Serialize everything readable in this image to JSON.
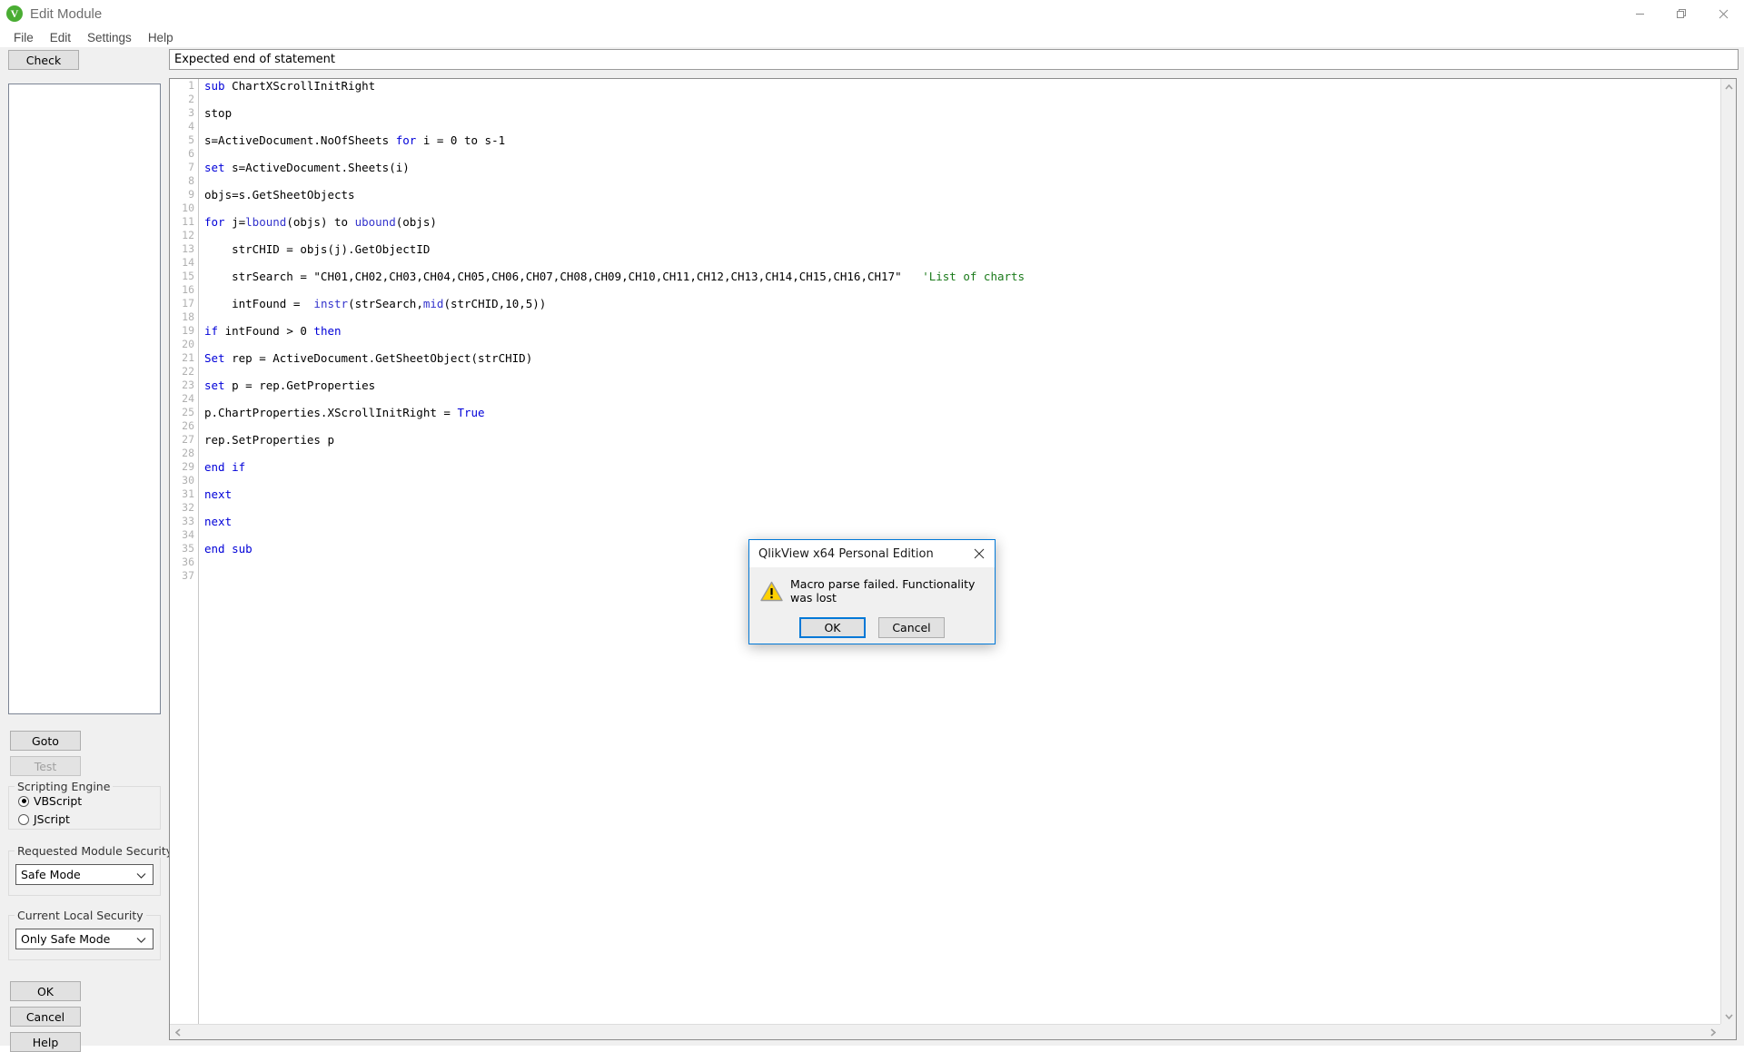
{
  "window": {
    "title": "Edit Module",
    "icon": "qlikview-logo-icon",
    "minimize_label": "–",
    "restore_label": "❐",
    "close_label": "✕"
  },
  "menubar": {
    "items": [
      {
        "label": "File"
      },
      {
        "label": "Edit"
      },
      {
        "label": "Settings"
      },
      {
        "label": "Help"
      }
    ]
  },
  "toolbar": {
    "check_label": "Check",
    "error_message": "Expected end of statement"
  },
  "sidebar": {
    "goto_label": "Goto",
    "test_label": "Test",
    "ok_label": "OK",
    "cancel_label": "Cancel",
    "help_label": "Help",
    "scripting_engine": {
      "title": "Scripting Engine",
      "options": [
        {
          "label": "VBScript",
          "selected": true
        },
        {
          "label": "JScript",
          "selected": false
        }
      ]
    },
    "requested_module_security": {
      "title": "Requested Module Security",
      "value": "Safe Mode"
    },
    "current_local_security": {
      "title": "Current Local Security",
      "value": "Only Safe Mode"
    }
  },
  "editor": {
    "total_lines": 37,
    "lines": [
      {
        "n": 1,
        "tokens": [
          {
            "t": "sub",
            "c": "kw"
          },
          {
            "t": " ChartXScrollInitRight",
            "c": ""
          }
        ]
      },
      {
        "n": 2,
        "tokens": []
      },
      {
        "n": 3,
        "tokens": [
          {
            "t": "stop",
            "c": ""
          }
        ]
      },
      {
        "n": 4,
        "tokens": []
      },
      {
        "n": 5,
        "tokens": [
          {
            "t": "s=ActiveDocument.NoOfSheets ",
            "c": ""
          },
          {
            "t": "for",
            "c": "kw"
          },
          {
            "t": " i = 0 to s-1",
            "c": ""
          }
        ]
      },
      {
        "n": 6,
        "tokens": []
      },
      {
        "n": 7,
        "tokens": [
          {
            "t": "set",
            "c": "kw"
          },
          {
            "t": " s=ActiveDocument.Sheets(i)",
            "c": ""
          }
        ]
      },
      {
        "n": 8,
        "tokens": []
      },
      {
        "n": 9,
        "tokens": [
          {
            "t": "objs=s.GetSheetObjects",
            "c": ""
          }
        ]
      },
      {
        "n": 10,
        "tokens": []
      },
      {
        "n": 11,
        "tokens": [
          {
            "t": "for",
            "c": "kw"
          },
          {
            "t": " j=",
            "c": ""
          },
          {
            "t": "lbound",
            "c": "fn"
          },
          {
            "t": "(objs) to ",
            "c": ""
          },
          {
            "t": "ubound",
            "c": "fn"
          },
          {
            "t": "(objs)",
            "c": ""
          }
        ]
      },
      {
        "n": 12,
        "tokens": []
      },
      {
        "n": 13,
        "tokens": [
          {
            "t": "    strCHID = objs(j).GetObjectID",
            "c": ""
          }
        ]
      },
      {
        "n": 14,
        "tokens": []
      },
      {
        "n": 15,
        "tokens": [
          {
            "t": "    strSearch = \"CH01,CH02,CH03,CH04,CH05,CH06,CH07,CH08,CH09,CH10,CH11,CH12,CH13,CH14,CH15,CH16,CH17\"   ",
            "c": ""
          },
          {
            "t": "'List of charts",
            "c": "cmt"
          }
        ]
      },
      {
        "n": 16,
        "tokens": []
      },
      {
        "n": 17,
        "tokens": [
          {
            "t": "    intFound =  ",
            "c": ""
          },
          {
            "t": "instr",
            "c": "fn"
          },
          {
            "t": "(strSearch,",
            "c": ""
          },
          {
            "t": "mid",
            "c": "fn"
          },
          {
            "t": "(strCHID,10,5))",
            "c": ""
          }
        ]
      },
      {
        "n": 18,
        "tokens": []
      },
      {
        "n": 19,
        "tokens": [
          {
            "t": "if",
            "c": "kw"
          },
          {
            "t": " intFound > 0 ",
            "c": ""
          },
          {
            "t": "then",
            "c": "kw"
          }
        ]
      },
      {
        "n": 20,
        "tokens": []
      },
      {
        "n": 21,
        "tokens": [
          {
            "t": "Set",
            "c": "kw"
          },
          {
            "t": " rep = ActiveDocument.GetSheetObject(strCHID)",
            "c": ""
          }
        ]
      },
      {
        "n": 22,
        "tokens": []
      },
      {
        "n": 23,
        "tokens": [
          {
            "t": "set",
            "c": "kw"
          },
          {
            "t": " p = rep.GetProperties",
            "c": ""
          }
        ]
      },
      {
        "n": 24,
        "tokens": []
      },
      {
        "n": 25,
        "tokens": [
          {
            "t": "p.ChartProperties.XScrollInitRight = ",
            "c": ""
          },
          {
            "t": "True",
            "c": "kw"
          }
        ]
      },
      {
        "n": 26,
        "tokens": []
      },
      {
        "n": 27,
        "tokens": [
          {
            "t": "rep.SetProperties p",
            "c": ""
          }
        ]
      },
      {
        "n": 28,
        "tokens": []
      },
      {
        "n": 29,
        "tokens": [
          {
            "t": "end if",
            "c": "kw"
          }
        ]
      },
      {
        "n": 30,
        "tokens": []
      },
      {
        "n": 31,
        "tokens": [
          {
            "t": "next",
            "c": "kw"
          }
        ]
      },
      {
        "n": 32,
        "tokens": []
      },
      {
        "n": 33,
        "tokens": [
          {
            "t": "next",
            "c": "kw"
          }
        ]
      },
      {
        "n": 34,
        "tokens": []
      },
      {
        "n": 35,
        "tokens": [
          {
            "t": "end sub",
            "c": "kw"
          }
        ]
      },
      {
        "n": 36,
        "tokens": []
      },
      {
        "n": 37,
        "tokens": []
      }
    ]
  },
  "dialog": {
    "title": "QlikView x64 Personal Edition",
    "close_label": "✕",
    "message": "Macro parse failed. Functionality was lost",
    "icon": "warning-triangle-icon",
    "buttons": [
      {
        "label": "OK",
        "default": true
      },
      {
        "label": "Cancel",
        "default": false
      }
    ]
  },
  "colors": {
    "accent": "#0078d7",
    "keyword": "#0000d8",
    "comment": "#1a7a1a",
    "logo_green": "#4aad33",
    "warning_yellow": "#ffd100"
  }
}
